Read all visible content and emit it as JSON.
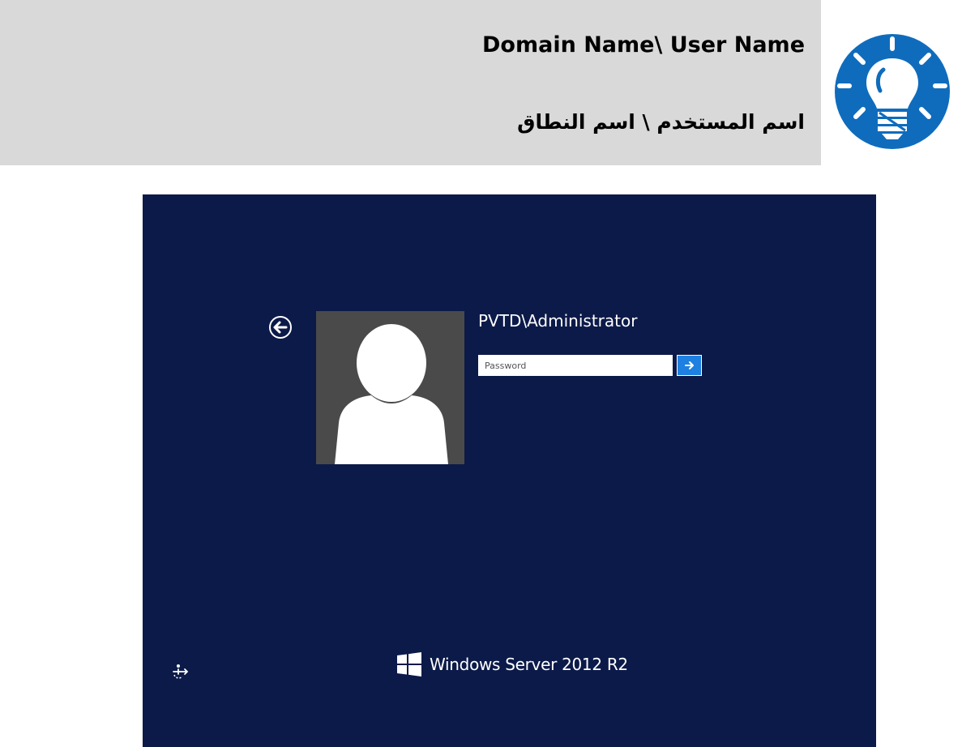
{
  "tip": {
    "title_en": "Domain Name\\ User Name",
    "title_ar": "اسم المستخدم \\ اسم النطاق",
    "icon": "lightbulb-icon",
    "icon_color": "#0f6cbd"
  },
  "login": {
    "background": "#0c1a49",
    "username": "PVTD\\Administrator",
    "password": {
      "placeholder": "Password",
      "value": ""
    },
    "submit_icon": "arrow-right-icon",
    "back_icon": "back-arrow-icon",
    "ease_of_access_icon": "ease-of-access-icon",
    "brand": {
      "logo": "windows-logo-icon",
      "text": "Windows Server 2012 R2"
    }
  }
}
